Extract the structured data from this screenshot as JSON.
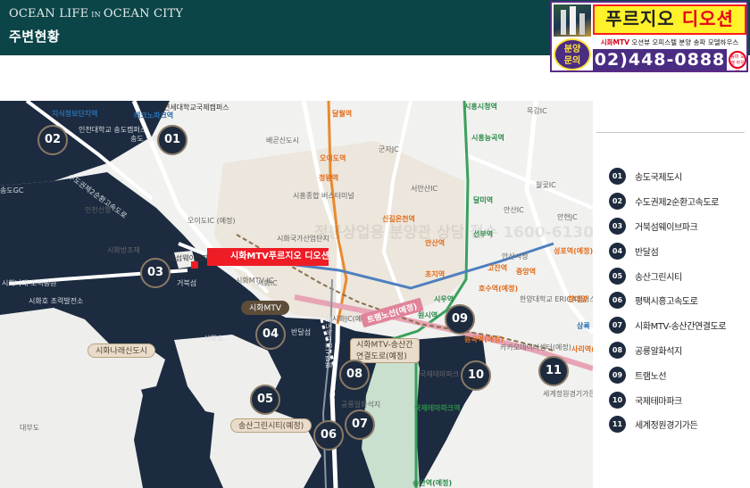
{
  "header": {
    "brand_main": "OCEAN LIFE",
    "brand_in": "IN",
    "brand_city": "OCEAN CITY",
    "title": "주변현황"
  },
  "ad": {
    "title_a": "푸르지오",
    "title_b": "디오션",
    "subtitle_red": "시화MTV",
    "subtitle": "오션뷰 오피스텔 분양 송파 모델하우스",
    "badge_line1": "분양",
    "badge_line2": "문의",
    "phone": "02)448-0888",
    "stamp": "송파 모델 하우스"
  },
  "map": {
    "highlight": "시화MTV푸르지오 디오션",
    "watermark": "정봉상업용 분양관  상담 접수 1600-6130",
    "pins": [
      "01",
      "02",
      "03",
      "04",
      "05",
      "06",
      "07",
      "08",
      "09",
      "10",
      "11"
    ],
    "pills": {
      "mtv": "시화MTV",
      "narae": "시화나래신도시",
      "songsan": "송산그린시티(예정)",
      "songsan_conn": "시화MTV-송산간\n연결도로(예정)"
    },
    "line_label": "트램노선(예정)",
    "labels": {
      "l01": "연세대학교국제캠퍼스",
      "l02": "지식정보단지역",
      "l03": "테크노파크역",
      "l04": "인천대학교\n송도캠퍼스",
      "l05": "송도\n국제도시",
      "l06": "배곧신도시",
      "l07": "달월역",
      "l08": "오이도역",
      "l09": "정왕역",
      "l10": "시흥종합\n버스터미널",
      "l11": "군자JC",
      "l12": "서안산IC",
      "l13": "시흥시청역",
      "l14": "시흥능곡역",
      "l15": "달미역",
      "l16": "선부역",
      "l17": "신길온천역",
      "l18": "안산역",
      "l19": "초지역",
      "l20": "시우역",
      "l21": "원시역",
      "l22": "고잔역",
      "l23": "중앙역",
      "l24": "호수역(예정)",
      "l25": "안산시청",
      "l26": "한양대학교\nERICA캠퍼스",
      "l27": "카카오데이터센터(예정)",
      "l28": "성포역(예정)",
      "l29": "한대앞",
      "l30": "상록",
      "l31": "사리역(예정)",
      "l32": "세계정원경기가든(예정)",
      "l33": "인천신항",
      "l34": "시화방조제",
      "l35": "오이도IC\n(예정)",
      "l36": "시화국가산업단지",
      "l37": "시화MTV IC",
      "l38": "시화IC",
      "l39": "시화JC(예정)",
      "l40": "거북섬",
      "l41": "반달섬",
      "l42": "시화호",
      "l43": "시화나래\n조력공원",
      "l44": "시화호\n조력발전소",
      "l45": "대부도",
      "l46": "국제테마파크역",
      "l47": "국제테마파크",
      "l48": "공룡알화석지",
      "l49": "송산역(예정)",
      "l50": "월곶IC",
      "l51": "안산IC",
      "l52": "안현JC",
      "l53": "목감IC",
      "l54": "송도GC",
      "l55": "원곡역(예정)",
      "l56": "거북섬웨이브파크",
      "l57": "수도권제2순환고속도로",
      "l58": "평택시흥고속도로"
    }
  },
  "legend": {
    "items": [
      {
        "num": "01",
        "label": "송도국제도시"
      },
      {
        "num": "02",
        "label": "수도권제2순환고속도로"
      },
      {
        "num": "03",
        "label": "거북섬웨이브파크"
      },
      {
        "num": "04",
        "label": "반달섬"
      },
      {
        "num": "05",
        "label": "송산그린시티"
      },
      {
        "num": "06",
        "label": "평택시흥고속도로"
      },
      {
        "num": "07",
        "label": "시화MTV-송산간연결도로"
      },
      {
        "num": "08",
        "label": "공룡알화석지"
      },
      {
        "num": "09",
        "label": "트램노선"
      },
      {
        "num": "10",
        "label": "국제테마파크"
      },
      {
        "num": "11",
        "label": "세계정원경기가든"
      }
    ]
  }
}
